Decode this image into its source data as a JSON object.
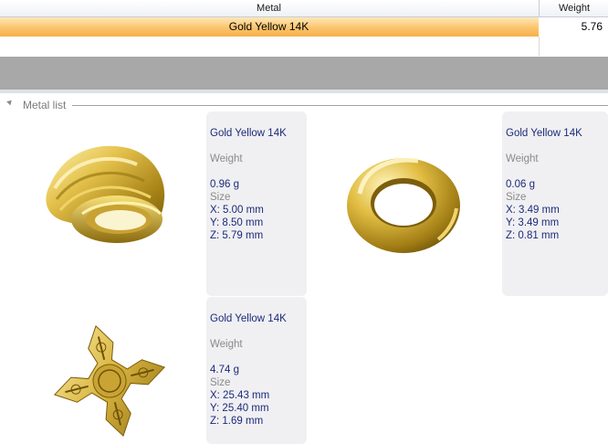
{
  "table": {
    "columns": {
      "metal": "Metal",
      "weight": "Weight"
    },
    "rows": [
      {
        "metal": "Gold Yellow 14K",
        "weight": "5.76"
      }
    ]
  },
  "group": {
    "label": "Metal list"
  },
  "items": [
    {
      "name": "Gold Yellow 14K",
      "weight_label": "Weight",
      "weight": "0.96 g",
      "size_label": "Size",
      "x": "X: 5.00 mm",
      "y": "Y: 8.50 mm",
      "z": "Z: 5.79 mm",
      "image_icon": "pendant-bail"
    },
    {
      "name": "Gold Yellow 14K",
      "weight_label": "Weight",
      "weight": "0.06 g",
      "size_label": "Size",
      "x": "X: 3.49 mm",
      "y": "Y: 3.49 mm",
      "z": "Z: 0.81 mm",
      "image_icon": "jump-ring"
    },
    {
      "name": "Gold Yellow 14K",
      "weight_label": "Weight",
      "weight": "4.74 g",
      "size_label": "Size",
      "x": "X: 25.43 mm",
      "y": "Y: 25.40 mm",
      "z": "Z: 1.69 mm",
      "image_icon": "cross-pendant"
    }
  ],
  "colors": {
    "selection": "#fbc46c",
    "text_blue": "#1c2a78",
    "gold": "#d6b43c"
  }
}
